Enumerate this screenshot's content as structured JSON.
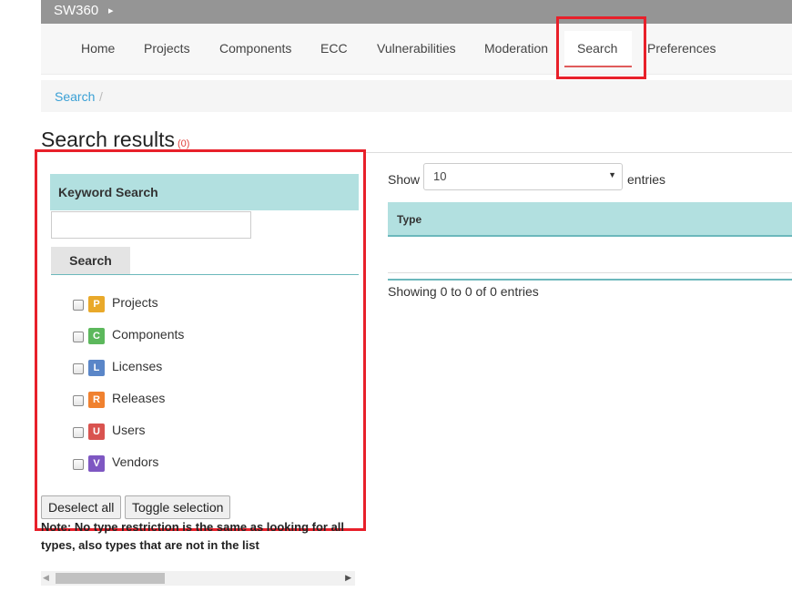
{
  "topbar": {
    "brand": "SW360",
    "brand_caret": "▸"
  },
  "nav": {
    "items": [
      "Home",
      "Projects",
      "Components",
      "ECC",
      "Vulnerabilities",
      "Moderation",
      "Search",
      "Preferences"
    ],
    "active": "Search"
  },
  "breadcrumb": {
    "items": [
      "Search"
    ],
    "separator": "/"
  },
  "page": {
    "title": "Search results",
    "count": "(0)"
  },
  "keyword_search": {
    "heading": "Keyword Search",
    "input_value": "",
    "search_button": "Search"
  },
  "types": [
    {
      "badge": "P",
      "label": "Projects",
      "color": "#e9a92a",
      "checked": false
    },
    {
      "badge": "C",
      "label": "Components",
      "color": "#5cb85c",
      "checked": false
    },
    {
      "badge": "L",
      "label": "Licenses",
      "color": "#5a86c8",
      "checked": false
    },
    {
      "badge": "R",
      "label": "Releases",
      "color": "#f0812f",
      "checked": false
    },
    {
      "badge": "U",
      "label": "Users",
      "color": "#d9534f",
      "checked": false
    },
    {
      "badge": "V",
      "label": "Vendors",
      "color": "#7e57c2",
      "checked": false
    }
  ],
  "buttons": {
    "deselect_all": "Deselect all",
    "toggle_selection": "Toggle selection"
  },
  "note": "Note: No type restriction is the same as looking for all types, also types that are not in the list",
  "table": {
    "show_label": "Show",
    "entries_value": "10",
    "entries_label": "entries",
    "columns": [
      "Type"
    ],
    "info": "Showing 0 to 0 of 0 entries"
  },
  "colors": {
    "accent": "#3aa0d5",
    "header_teal": "#b2e0e0",
    "highlight_red": "#e8202a",
    "nav_bar": "#959595"
  }
}
